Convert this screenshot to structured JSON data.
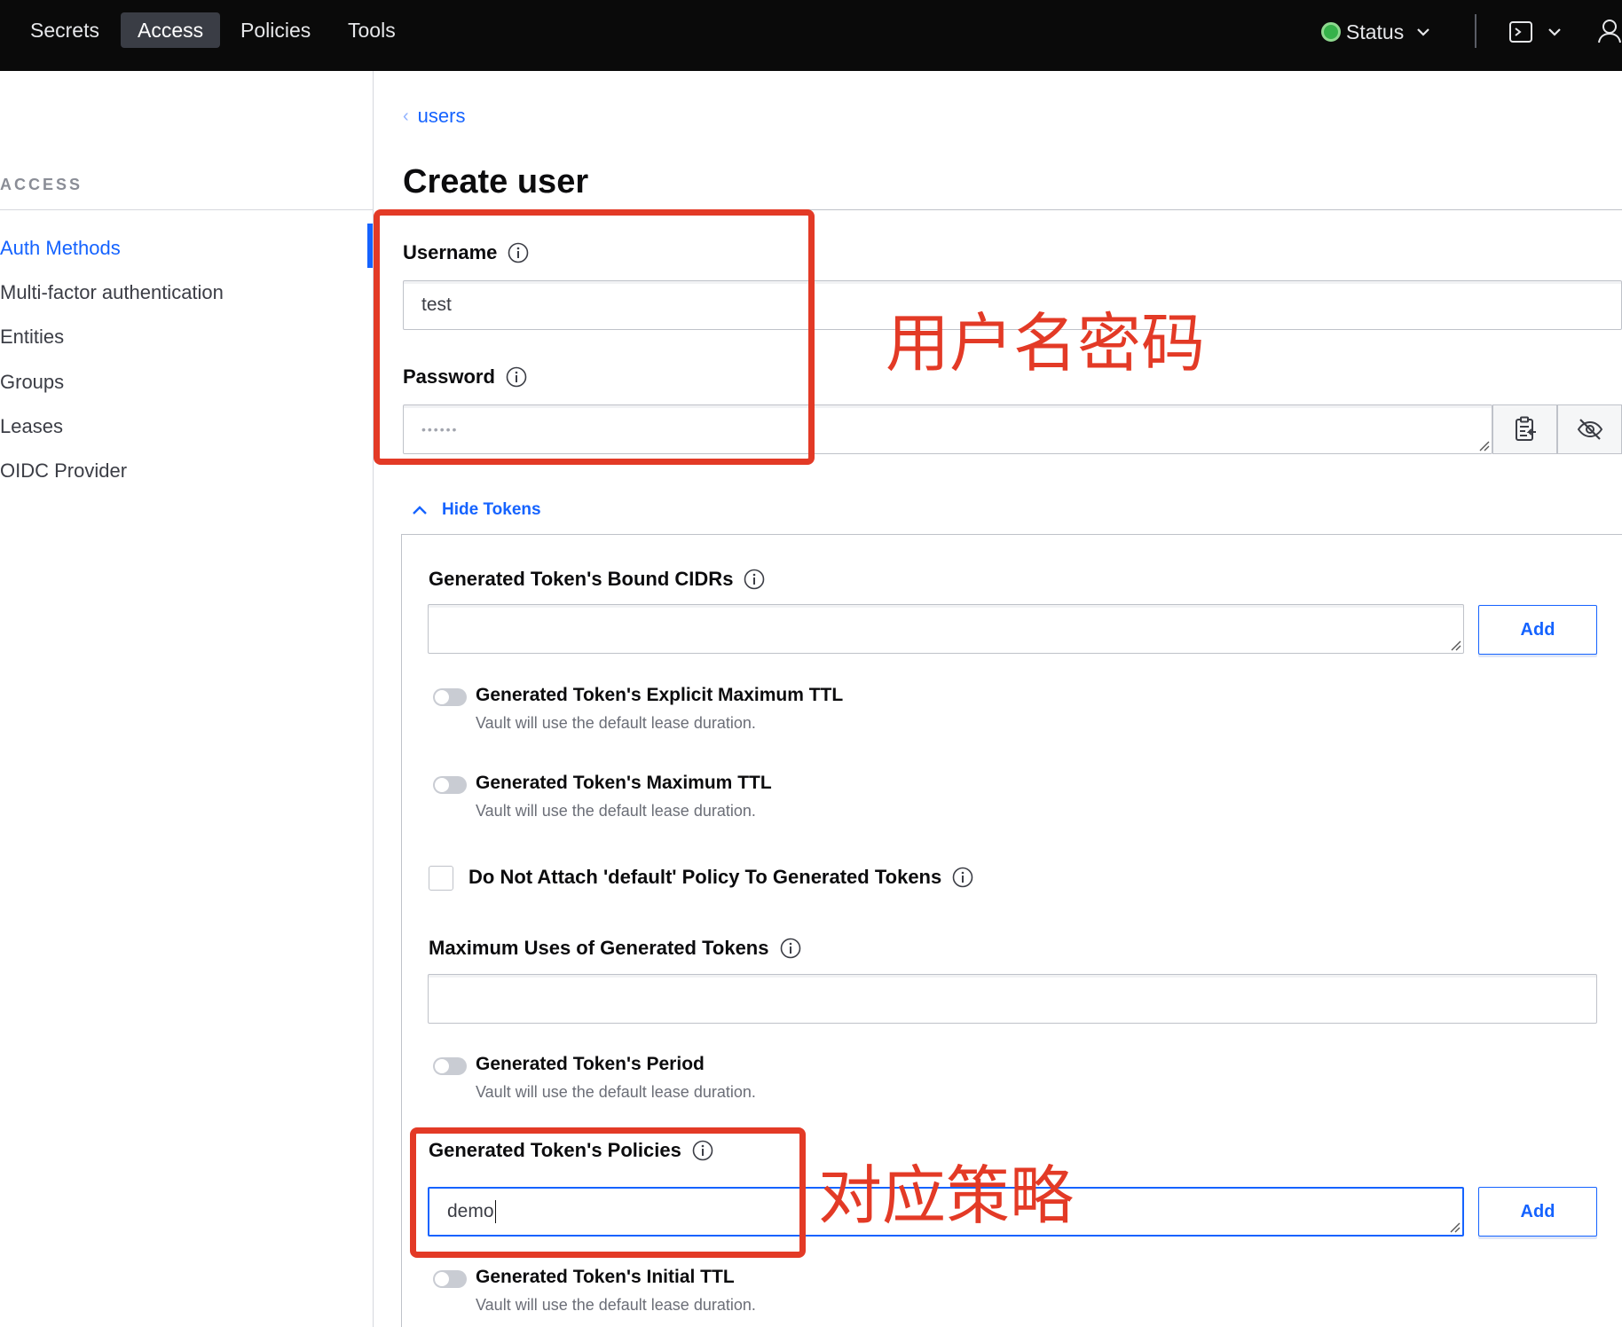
{
  "nav": {
    "items": [
      "Secrets",
      "Access",
      "Policies",
      "Tools"
    ],
    "active": "Access",
    "status_label": "Status",
    "colors": {
      "bar": "#0a0a0a",
      "status_ok": "#36b24a"
    }
  },
  "sidebar": {
    "heading": "ACCESS",
    "items": [
      {
        "label": "Auth Methods",
        "active": true
      },
      {
        "label": "Multi-factor authentication"
      },
      {
        "label": "Entities"
      },
      {
        "label": "Groups"
      },
      {
        "label": "Leases"
      },
      {
        "label": "OIDC Provider"
      }
    ]
  },
  "main": {
    "breadcrumb": "users",
    "title": "Create user",
    "username": {
      "label": "Username",
      "value": "test"
    },
    "password": {
      "label": "Password",
      "masked_value": "••••••"
    },
    "hide_tokens_label": "Hide Tokens",
    "tokens": {
      "bound_cidrs_label": "Generated Token's Bound CIDRs",
      "add_label": "Add",
      "explicit_max_ttl": {
        "title": "Generated Token's Explicit Maximum TTL",
        "help": "Vault will use the default lease duration."
      },
      "max_ttl": {
        "title": "Generated Token's Maximum TTL",
        "help": "Vault will use the default lease duration."
      },
      "no_default_policy_label": "Do Not Attach 'default' Policy To Generated Tokens",
      "max_uses_label": "Maximum Uses of Generated Tokens",
      "period": {
        "title": "Generated Token's Period",
        "help": "Vault will use the default lease duration."
      },
      "policies": {
        "label": "Generated Token's Policies",
        "value": "demo"
      },
      "initial_ttl": {
        "title": "Generated Token's Initial TTL",
        "help": "Vault will use the default lease duration."
      }
    }
  },
  "annotations": {
    "credentials_note": "用户名密码",
    "policy_note": "对应策略",
    "color": "#e33a26"
  },
  "accent_color": "#1563ff"
}
